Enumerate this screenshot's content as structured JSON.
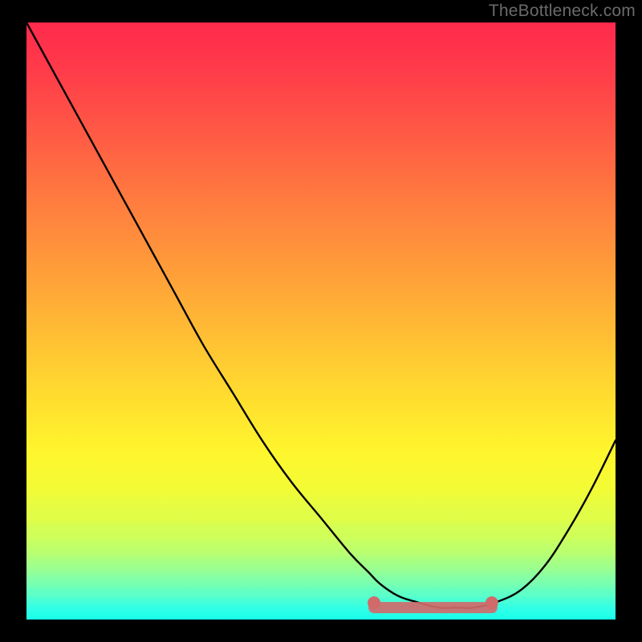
{
  "watermark": "TheBottleneck.com",
  "chart_data": {
    "type": "line",
    "title": "",
    "xlabel": "",
    "ylabel": "",
    "xlim": [
      0,
      100
    ],
    "ylim": [
      0,
      100
    ],
    "grid": false,
    "series": [
      {
        "name": "bottleneck-curve",
        "x": [
          0,
          5,
          10,
          15,
          20,
          25,
          30,
          35,
          40,
          45,
          50,
          55,
          58,
          60,
          63,
          66,
          70,
          73,
          76,
          80,
          84,
          88,
          92,
          96,
          100
        ],
        "y": [
          100,
          91,
          82,
          73,
          64,
          55,
          46,
          38,
          30,
          23,
          17,
          11,
          8,
          6,
          4,
          3,
          2,
          2,
          2,
          3,
          5,
          9,
          15,
          22,
          30
        ]
      }
    ],
    "annotations": [
      {
        "name": "optimal-zone",
        "x_start": 59,
        "x_end": 79,
        "y": 2,
        "color": "#d16a6a"
      }
    ],
    "background": {
      "type": "vertical-gradient",
      "stops": [
        {
          "pos": 0.0,
          "color": "#ff2a4c"
        },
        {
          "pos": 0.5,
          "color": "#ffc932"
        },
        {
          "pos": 0.75,
          "color": "#fff62d"
        },
        {
          "pos": 1.0,
          "color": "#17ffe8"
        }
      ]
    }
  }
}
